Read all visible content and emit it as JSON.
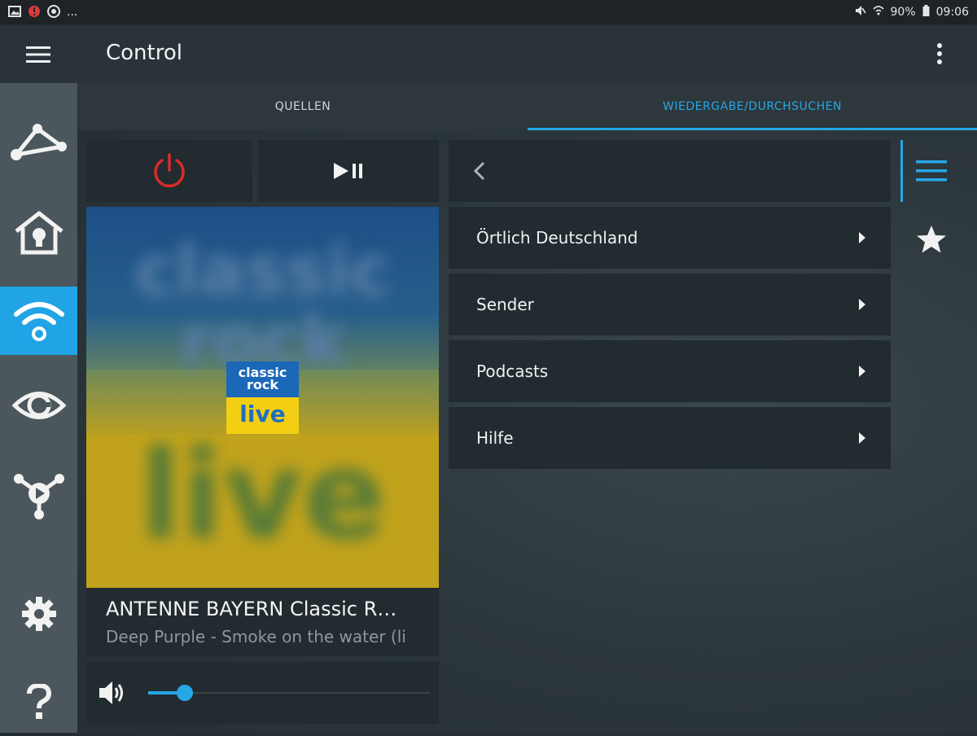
{
  "status_bar": {
    "left_icons": [
      "image-icon",
      "alert-icon",
      "chrome-icon"
    ],
    "more": "...",
    "battery": "90%",
    "time": "09:06"
  },
  "app_bar": {
    "title": "Control"
  },
  "tabs": [
    {
      "label": "QUELLEN",
      "active": false
    },
    {
      "label": "WIEDERGABE/DURCHSUCHEN",
      "active": true
    }
  ],
  "sidebar": {
    "items": [
      {
        "icon": "network-icon",
        "active": false
      },
      {
        "icon": "smart-home-icon",
        "active": false
      },
      {
        "icon": "wifi-radio-icon",
        "active": true
      },
      {
        "icon": "eye-icon",
        "active": false
      },
      {
        "icon": "media-share-icon",
        "active": false
      },
      {
        "icon": "gear-icon",
        "active": false
      },
      {
        "icon": "help-icon",
        "active": false
      }
    ]
  },
  "controls": {
    "power_color": "#d62b2b"
  },
  "album_art": {
    "logo_line1": "classic",
    "logo_line2": "rock",
    "logo_line3": "live"
  },
  "now_playing": {
    "station": "ANTENNE BAYERN Classic R…",
    "track": "Deep Purple - Smoke on the water (li"
  },
  "volume": {
    "level": 0.13
  },
  "browse_list": [
    {
      "label": "Örtlich Deutschland"
    },
    {
      "label": "Sender"
    },
    {
      "label": "Podcasts"
    },
    {
      "label": "Hilfe"
    }
  ],
  "colors": {
    "accent": "#27a7e6",
    "power": "#d62b2b"
  }
}
